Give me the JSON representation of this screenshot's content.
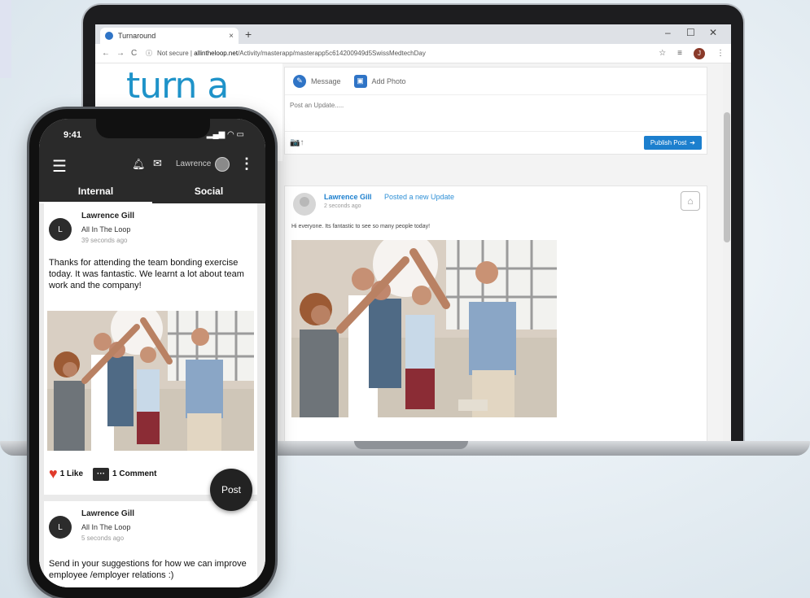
{
  "browser": {
    "tab_title": "Turnaround",
    "tab_close": "×",
    "new_tab": "+",
    "window_controls": {
      "minimize": "–",
      "maximize": "☐",
      "close": "✕"
    },
    "nav": {
      "back": "←",
      "forward": "→",
      "reload": "C"
    },
    "security_label": "Not secure",
    "url_domain": "allintheloop.net",
    "url_path": "/Activity/masterapp/masterapp5c614200949d5SwissMedtechDay",
    "profile_initial": "J"
  },
  "site": {
    "logo_text": "turn a"
  },
  "composer": {
    "message_tab": "Message",
    "add_photo_tab": "Add Photo",
    "placeholder": "Post an Update.....",
    "publish_label": "Publish Post"
  },
  "desktop_post": {
    "author": "Lawrence Gill",
    "action": "Posted a new Update",
    "time": "2 seconds ago",
    "text": "Hi everyone. Its fantastic to see so many people today!"
  },
  "phone": {
    "time": "9:41",
    "user_name": "Lawrence",
    "tabs": [
      "Internal",
      "Social"
    ],
    "posts": [
      {
        "avatar_initial": "L",
        "author": "Lawrence Gill",
        "org": "All In The Loop",
        "time": "39 seconds ago",
        "text": "Thanks for attending the team bonding exercise today. It was fantastic. We learnt a lot about team work and the company!",
        "likes": "1 Like",
        "comments": "1 Comment"
      },
      {
        "avatar_initial": "L",
        "author": "Lawrence Gill",
        "org": "All In The Loop",
        "time": "5 seconds ago",
        "text": "Send in your suggestions for how we can improve employee /employer relations :)"
      }
    ],
    "fab_label": "Post"
  }
}
